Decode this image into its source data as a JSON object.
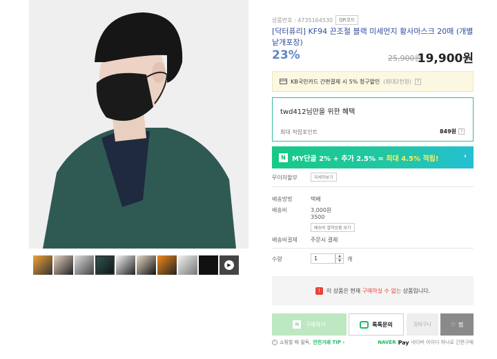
{
  "product": {
    "id_label": "상품번호 : 4735164530",
    "qr_label": "QR코드",
    "title": "[닥터퓨리] KF94 끈조절 블랙 미세먼지 황사마스크 20매 (개별 낱개포장)",
    "discount": "23%",
    "original_price": "25,900원",
    "sale_price": "19,900원"
  },
  "card_banner": {
    "text": "KB국민카드 간편결제 시 5% 청구할인",
    "max": "(최대2천원)",
    "help": "?"
  },
  "benefit": {
    "title": "twd412님만을 위한 혜택",
    "points_label": "최대 적립포인트",
    "points_value": "849원",
    "help": "?"
  },
  "my_banner": {
    "badge": "N",
    "text_a": "MY단골 2% + 추가 2.5% = ",
    "text_b": "최대 4.5% 적립!",
    "arrow": "›"
  },
  "details": {
    "installment_label": "무이자할부",
    "installment_btn": "자세히보기",
    "ship_method_label": "배송방법",
    "ship_method_value": "택배",
    "ship_fee_label": "배송비",
    "ship_fee_value": "3,000원",
    "ship_fee_extra": "3500",
    "ship_fee_btn": "배송비 절약상품 보기",
    "ship_pay_label": "배송비결제",
    "ship_pay_value": "주문시 결제"
  },
  "quantity": {
    "label": "수량",
    "value": "1",
    "unit": "개",
    "up": "▲",
    "down": "▼"
  },
  "notice": {
    "icon": "!",
    "prefix": "이 상품은 현재 ",
    "red": "구매하실 수 없는",
    "suffix": " 상품입니다."
  },
  "buttons": {
    "buy_icon": "N",
    "buy": "구매하기",
    "talk_icon": "···",
    "talk": "톡톡문의",
    "cart": "장바구니",
    "zzim_icon": "♡",
    "zzim": "찜"
  },
  "footer": {
    "info_icon": "i",
    "text": "쇼핑할 때 필독, ",
    "link": "안전거래 TIP ›",
    "naver": "NAVER",
    "pay": "Pay",
    "pay_desc": "네이버 아이디 하나로 간편구매"
  },
  "colors": {
    "title_blue": "#2f4c9c",
    "discount_blue": "#5b86c6",
    "naver_green": "#1fb964",
    "warning_red": "#e8433b"
  },
  "thumbnails": [
    "thumb-1",
    "thumb-2",
    "thumb-3",
    "thumb-4",
    "thumb-5",
    "thumb-6",
    "thumb-7",
    "thumb-8",
    "thumb-video"
  ]
}
